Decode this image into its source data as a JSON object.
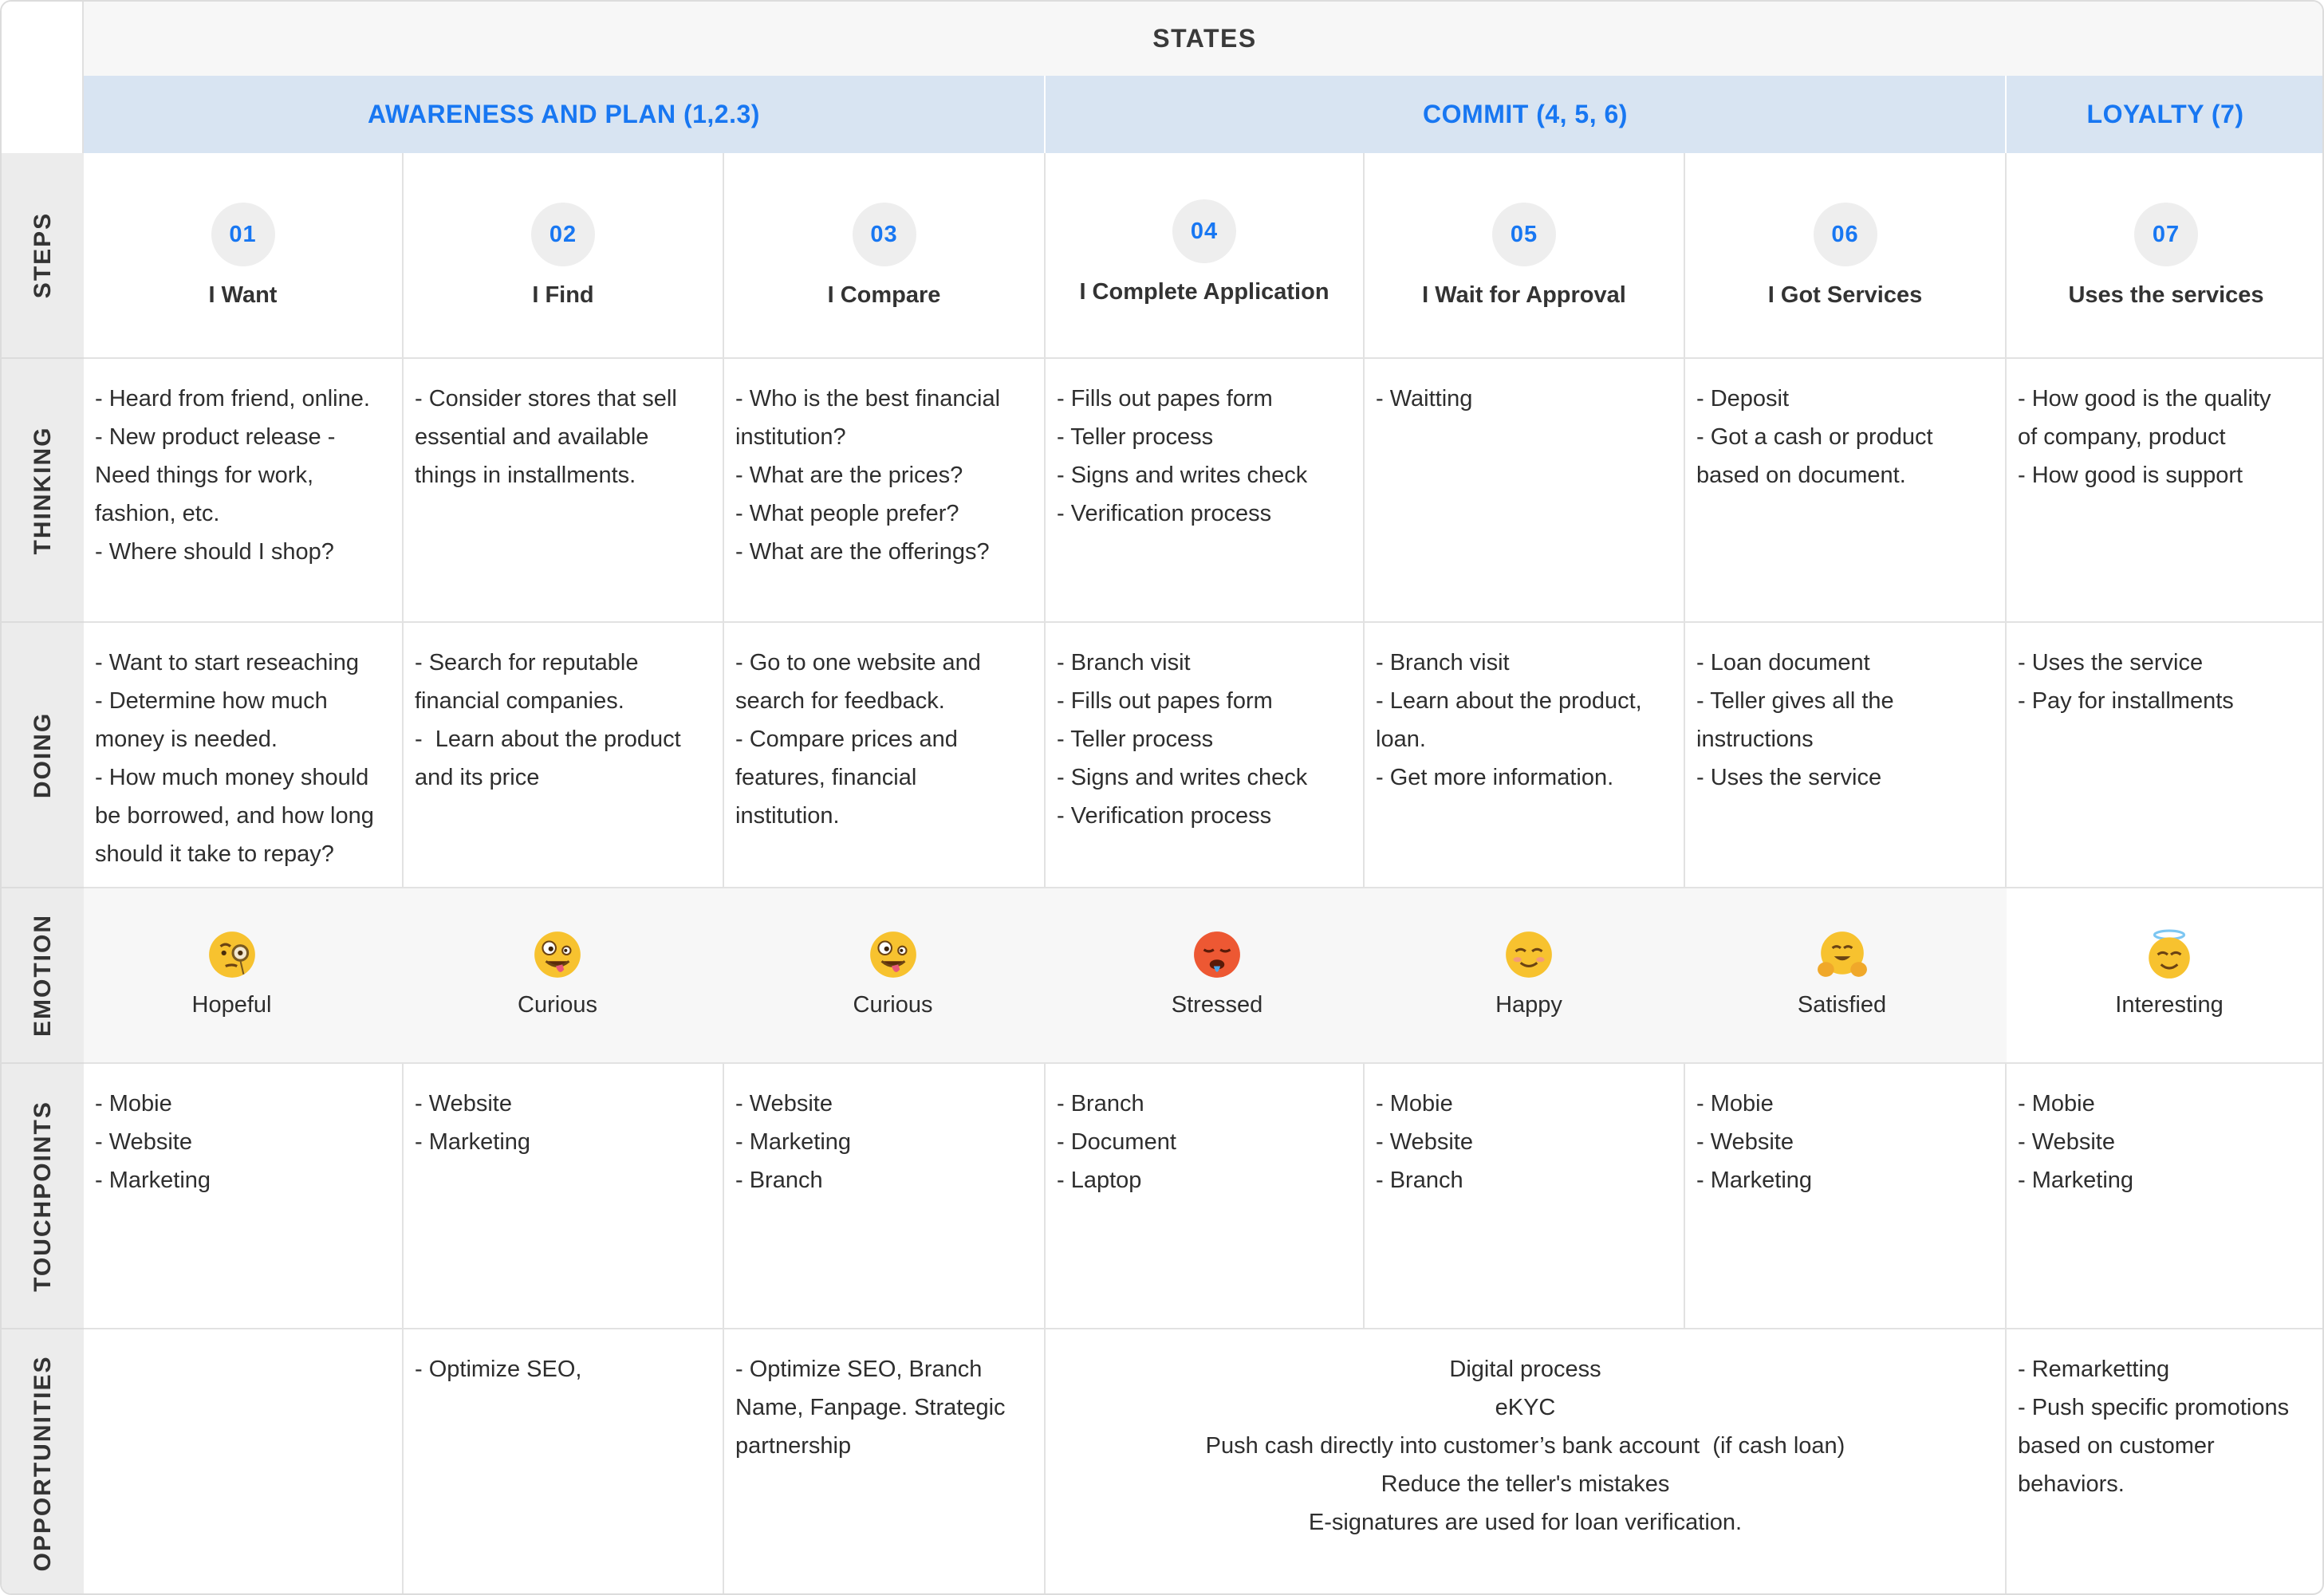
{
  "header": {
    "title": "STATES"
  },
  "phases": [
    {
      "label": "AWARENESS AND PLAN (1,2.3)"
    },
    {
      "label": "COMMIT (4, 5, 6)"
    },
    {
      "label": "LOYALTY (7)"
    }
  ],
  "rows": {
    "steps": "STEPS",
    "thinking": "THINKING",
    "doing": "DOING",
    "emotion": "EMOTION",
    "touchpoints": "TOUCHPOINTS",
    "opportunities": "OPPORTUNITIES"
  },
  "steps": [
    {
      "number": "01",
      "title": "I Want"
    },
    {
      "number": "02",
      "title": "I Find"
    },
    {
      "number": "03",
      "title": "I Compare"
    },
    {
      "number": "04",
      "title": "I Complete Application"
    },
    {
      "number": "05",
      "title": "I Wait for Approval"
    },
    {
      "number": "06",
      "title": "I Got Services"
    },
    {
      "number": "07",
      "title": "Uses the services"
    }
  ],
  "thinking": [
    [
      "- Heard from friend, online.",
      "- New product release -",
      "Need things for work,",
      "fashion, etc.",
      "- Where should I shop?"
    ],
    [
      "- Consider stores that sell",
      "essential and available",
      "things in installments."
    ],
    [
      "- Who is the best financial",
      "institution?",
      "- What are the prices?",
      "- What people prefer?",
      "- What are the offerings?"
    ],
    [
      "- Fills out papes form",
      "- Teller process",
      "- Signs and writes check",
      "- Verification process"
    ],
    [
      "- Waitting"
    ],
    [
      "- Deposit",
      "- Got a cash or product",
      "based on document."
    ],
    [
      "- How good is the quality",
      "of company, product",
      "- How good is support"
    ]
  ],
  "doing": [
    [
      "- Want to start reseaching",
      "- Determine how much",
      "money is needed.",
      "- How much money should",
      "be borrowed, and how long",
      "should it take to repay?"
    ],
    [
      "- Search for reputable",
      "financial companies.",
      "-  Learn about the product",
      "and its price"
    ],
    [
      "- Go to one website and",
      "search for feedback.",
      "- Compare prices and",
      "features, financial",
      "institution."
    ],
    [
      "- Branch visit",
      "- Fills out papes form",
      "- Teller process",
      "- Signs and writes check",
      "- Verification process"
    ],
    [
      "- Branch visit",
      "- Learn about the product,",
      "loan.",
      "- Get more information."
    ],
    [
      "- Loan document",
      "- Teller gives all the",
      "instructions",
      "- Uses the service"
    ],
    [
      "- Uses the service",
      "- Pay for installments"
    ]
  ],
  "emotions": [
    {
      "icon": "monocle-face-icon",
      "label": "Hopeful"
    },
    {
      "icon": "zany-face-icon",
      "label": "Curious"
    },
    {
      "icon": "zany-face-icon",
      "label": "Curious"
    },
    {
      "icon": "hot-face-icon",
      "label": "Stressed"
    },
    {
      "icon": "smiling-face-icon",
      "label": "Happy"
    },
    {
      "icon": "hugging-face-icon",
      "label": "Satisfied"
    },
    {
      "icon": "halo-face-icon",
      "label": "Interesting"
    }
  ],
  "touchpoints": [
    [
      "- Mobie",
      "- Website",
      "- Marketing"
    ],
    [
      "- Website",
      "- Marketing"
    ],
    [
      "- Website",
      "- Marketing",
      "- Branch"
    ],
    [
      "- Branch",
      "- Document",
      "- Laptop"
    ],
    [
      "- Mobie",
      "- Website",
      "- Branch"
    ],
    [
      "- Mobie",
      "- Website",
      "- Marketing"
    ],
    [
      "- Mobie",
      "- Website",
      "- Marketing"
    ]
  ],
  "opportunities": {
    "col1": [],
    "col2": [
      "- Optimize SEO,"
    ],
    "col3": [
      "- Optimize SEO, Branch",
      "Name, Fanpage. Strategic",
      "partnership"
    ],
    "commit": [
      "Digital process",
      "eKYC",
      "Push cash directly into customer’s bank account  (if cash loan)",
      "Reduce the teller's mistakes",
      "E-signatures are used for loan verification."
    ],
    "col7": [
      "- Remarketting",
      "- Push specific promotions",
      "based on customer",
      "behaviors."
    ]
  },
  "colors": {
    "accent": "#1877f2",
    "phase_bg": "#d8e4f2",
    "label_bg": "#ececec",
    "emotion_bg": "#f7f7f7"
  }
}
